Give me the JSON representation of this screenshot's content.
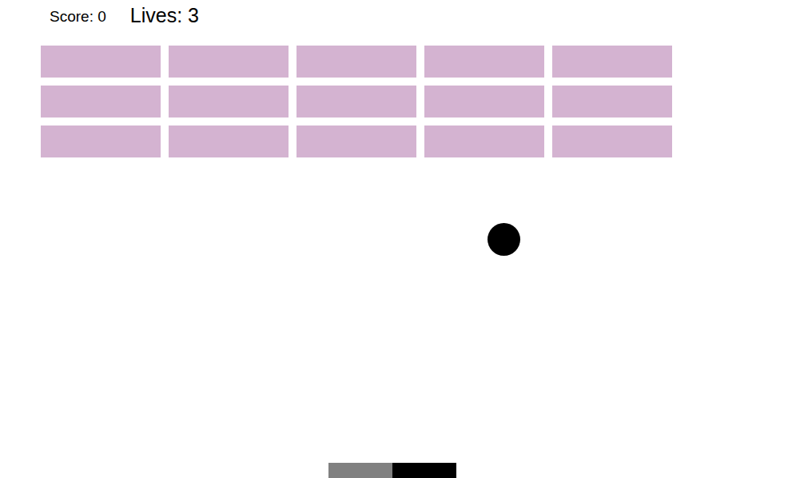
{
  "hud": {
    "score": "Score: 0",
    "lives": "Lives: 3"
  },
  "bricks": [
    [
      {
        "intact": true
      },
      {
        "intact": true
      },
      {
        "intact": true
      },
      {
        "intact": true
      },
      {
        "intact": true
      }
    ],
    [
      {
        "intact": true
      },
      {
        "intact": true
      },
      {
        "intact": true
      },
      {
        "intact": true
      },
      {
        "intact": true
      }
    ],
    [
      {
        "intact": true
      },
      {
        "intact": true
      },
      {
        "intact": true
      },
      {
        "intact": true
      },
      {
        "intact": true
      }
    ]
  ],
  "paddle": {
    "segments": [
      {
        "color": "#808080"
      },
      {
        "color": "#000000"
      }
    ]
  }
}
